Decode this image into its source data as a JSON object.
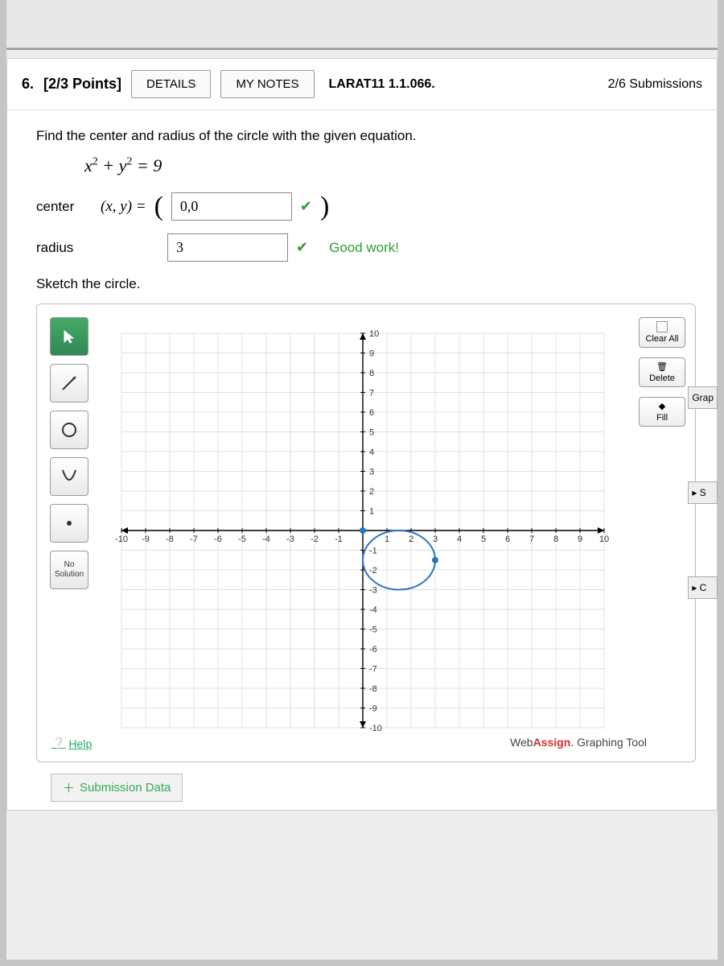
{
  "header": {
    "number": "6.",
    "points": "[2/3 Points]",
    "details_btn": "DETAILS",
    "notes_btn": "MY NOTES",
    "ref": "LARAT11 1.1.066.",
    "submissions": "2/6 Submissions"
  },
  "prompt": "Find the center and radius of the circle with the given equation.",
  "equation": "x² + y² = 9",
  "answers": {
    "center_label": "center",
    "center_expr": "(x, y) =",
    "center_value": "0,0",
    "radius_label": "radius",
    "radius_value": "3",
    "feedback": "Good work!"
  },
  "sketch_label": "Sketch the circle.",
  "tools": {
    "pointer": "pointer",
    "line": "line",
    "circle": "circle",
    "parabola": "parabola",
    "point": "point",
    "nosol_line1": "No",
    "nosol_line2": "Solution",
    "help": "Help"
  },
  "right_tools": {
    "clear": "Clear All",
    "delete": "Delete",
    "fill": "Fill"
  },
  "side_tabs": {
    "graph": "Grap",
    "s": "▸ S",
    "c": "▸ C"
  },
  "credit_prefix": "Web",
  "credit_bold": "Assign",
  "credit_suffix": ". Graphing Tool",
  "submission_data": "Submission Data",
  "chart_data": {
    "type": "scatter",
    "title": "",
    "xlabel": "",
    "ylabel": "",
    "xlim": [
      -10,
      10
    ],
    "ylim": [
      -10,
      10
    ],
    "x_ticks": [
      -10,
      -9,
      -8,
      -7,
      -6,
      -5,
      -4,
      -3,
      -2,
      -1,
      1,
      2,
      3,
      4,
      5,
      6,
      7,
      8,
      9,
      10
    ],
    "y_ticks": [
      -10,
      -9,
      -8,
      -7,
      -6,
      -5,
      -4,
      -3,
      -2,
      -1,
      1,
      2,
      3,
      4,
      5,
      6,
      7,
      8,
      9,
      10
    ],
    "shapes": [
      {
        "kind": "circle",
        "cx": 1.5,
        "cy": -1.5,
        "r": 1.5,
        "stroke": "#2a75c0",
        "fill": "none"
      }
    ],
    "points": [
      {
        "x": 0,
        "y": 0,
        "color": "#2a75c0"
      },
      {
        "x": 3,
        "y": -1.5,
        "color": "#2a75c0"
      }
    ]
  }
}
